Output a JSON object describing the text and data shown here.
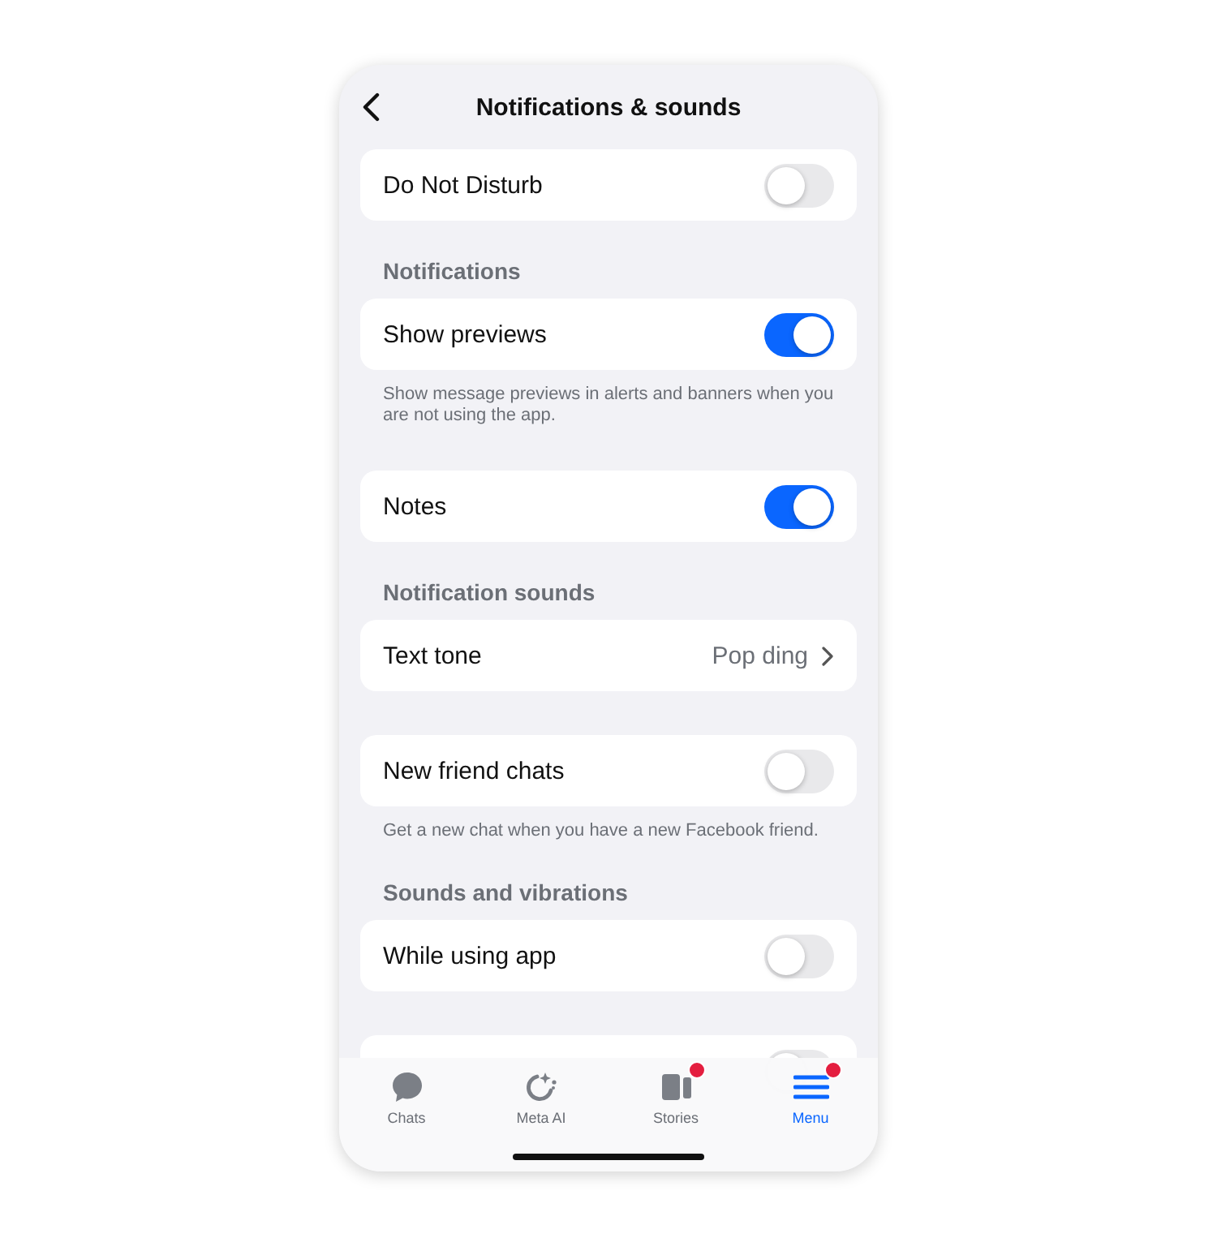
{
  "header": {
    "title": "Notifications & sounds"
  },
  "sections": [
    {
      "rows": [
        {
          "kind": "toggle",
          "label": "Do Not Disturb",
          "on": false
        }
      ]
    },
    {
      "header": "Notifications",
      "rows": [
        {
          "kind": "toggle",
          "label": "Show previews",
          "on": true
        }
      ],
      "footer": "Show message previews in alerts and banners when you are not using the app."
    },
    {
      "rows": [
        {
          "kind": "toggle",
          "label": "Notes",
          "on": true
        }
      ]
    },
    {
      "header": "Notification sounds",
      "rows": [
        {
          "kind": "link",
          "label": "Text tone",
          "value": "Pop ding"
        }
      ]
    },
    {
      "rows": [
        {
          "kind": "toggle",
          "label": "New friend chats",
          "on": false
        }
      ],
      "footer": "Get a new chat when you have a new Facebook friend."
    },
    {
      "header": "Sounds and vibrations",
      "rows": [
        {
          "kind": "toggle",
          "label": "While using app",
          "on": false
        }
      ]
    },
    {
      "rows": [
        {
          "kind": "toggle",
          "on": false
        }
      ]
    }
  ],
  "tab_bar": [
    {
      "kind": "chats",
      "label": "Chats",
      "selected": false,
      "badge": false
    },
    {
      "kind": "meta-ai",
      "label": "Meta AI",
      "selected": false,
      "badge": false
    },
    {
      "kind": "stories",
      "label": "Stories",
      "selected": false,
      "badge": true
    },
    {
      "kind": "menu",
      "label": "Menu",
      "selected": true,
      "badge": true
    }
  ]
}
